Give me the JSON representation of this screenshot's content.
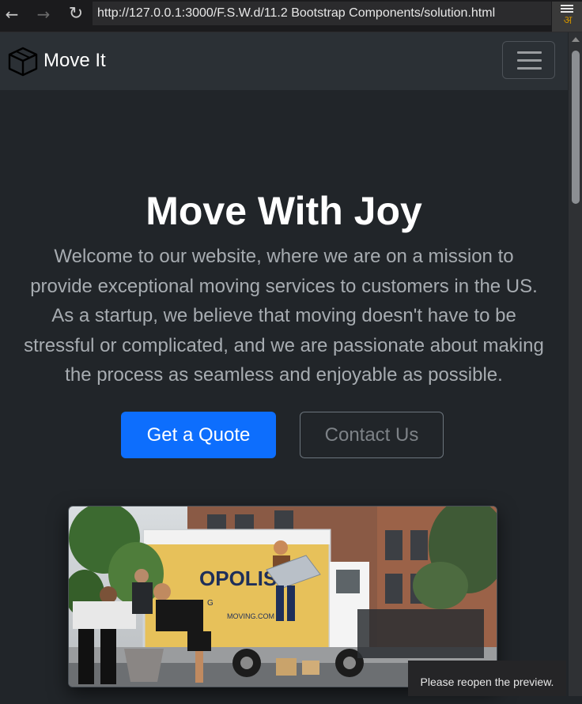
{
  "browser": {
    "back_icon": "arrow-left-icon",
    "forward_icon": "arrow-right-icon",
    "reload_icon": "reload-icon",
    "url": "http://127.0.0.1:3000/F.S.W.d/11.2 Bootstrap Components/solution.html",
    "menu_icon": "menu-icon"
  },
  "navbar": {
    "brand_icon": "box-icon",
    "brand": "Move It",
    "toggler_icon": "hamburger-icon"
  },
  "hero": {
    "title": "Move With Joy",
    "text": "Welcome to our website, where we are on a mission to provide exceptional moving services to customers in the US. As a startup, we believe that moving doesn't have to be stressful or complicated, and we are passionate about making the process as seamless and enjoyable as possible.",
    "primary_button": "Get a Quote",
    "secondary_button": "Contact Us"
  },
  "toast": {
    "text": "Please reopen the preview."
  },
  "colors": {
    "background": "#212529",
    "navbar": "#2b3035",
    "primary": "#0d6efd",
    "text_muted": "#a7acb1"
  }
}
